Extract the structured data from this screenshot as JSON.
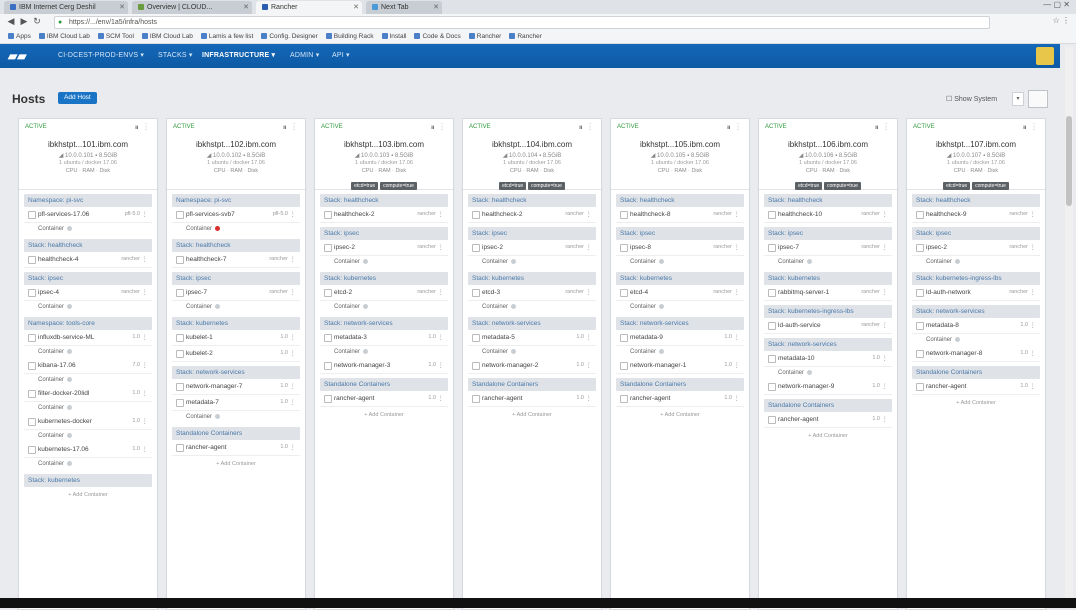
{
  "browser": {
    "tabs": [
      {
        "label": "IBM Internet Cerg Deshil",
        "color": "#3a6fc4",
        "active": false
      },
      {
        "label": "Overview | CLOUD...",
        "color": "#6a9b3c",
        "active": false
      },
      {
        "label": "Rancher",
        "color": "#2a5db0",
        "active": true
      },
      {
        "label": "Next Tab",
        "color": "#4a9ad8",
        "active": false
      }
    ],
    "url": "https://.../env/1a5/infra/hosts",
    "bookmarks": [
      "Apps",
      "IBM Cloud Lab",
      "SCM Tool",
      "IBM Cloud Lab",
      "Lamis a few list",
      "Config. Designer",
      "Building Rack",
      "Install",
      "Code & Docs",
      "Rancher",
      "Rancher"
    ]
  },
  "appnav": {
    "logo": "▰▰",
    "items": [
      {
        "label": "CI-DCEST-PROD-ENVS ▾",
        "active": false
      },
      {
        "label": "STACKS ▾",
        "active": false
      },
      {
        "label": "INFRASTRUCTURE ▾",
        "active": true
      },
      {
        "label": "ADMIN ▾",
        "active": false
      },
      {
        "label": "API ▾",
        "active": false
      }
    ]
  },
  "page": {
    "title": "Hosts",
    "add_host": "Add Host",
    "show_system": "Show System",
    "view_toggle": "▾"
  },
  "hosts": [
    {
      "state": "ACTIVE",
      "name": "ibkhstpt...101.ibm.com",
      "meta": "◢ 10.0.0.101 ▪ 8.5GiB",
      "sub": "1 ubuntu / docker 17.06",
      "stats": "CPU  ·  RAM  ·  Disk",
      "labels": [],
      "stacks": [
        {
          "title": "Namespace: pi-svc",
          "services": [
            {
              "name": "pfl-services-17.06",
              "ver": "pfl-5.0",
              "containers": 1,
              "red": false
            }
          ]
        },
        {
          "title": "Stack: healthcheck",
          "services": [
            {
              "name": "healthcheck-4",
              "ver": "rancher",
              "containers": 0,
              "red": false
            }
          ]
        },
        {
          "title": "Stack: ipsec",
          "services": [
            {
              "name": "ipsec-4",
              "ver": "rancher",
              "containers": 1,
              "red": false
            }
          ]
        },
        {
          "title": "Namespace: tools-core",
          "services": [
            {
              "name": "influxdb-service-ML",
              "ver": "1.0",
              "containers": 1,
              "red": false
            },
            {
              "name": "kibana-17.06",
              "ver": "7.0",
              "containers": 1,
              "red": false
            },
            {
              "name": "filter-docker-20lidl",
              "ver": "1.0",
              "containers": 1,
              "red": false
            },
            {
              "name": "kubernetes-docker",
              "ver": "1.0",
              "containers": 1,
              "red": false
            },
            {
              "name": "kubernetes-17.06",
              "ver": "1.0",
              "containers": 1,
              "red": false
            }
          ]
        },
        {
          "title": "Stack: kubernetes",
          "services": []
        }
      ]
    },
    {
      "state": "ACTIVE",
      "name": "ibkhstpt...102.ibm.com",
      "meta": "◢ 10.0.0.102 ▪ 8.5GiB",
      "sub": "1 ubuntu / docker 17.06",
      "stats": "CPU  ·  RAM  ·  Disk",
      "labels": [],
      "stacks": [
        {
          "title": "Namespace: pi-svc",
          "services": [
            {
              "name": "pfl-services-svb7",
              "ver": "pfl-5.0",
              "containers": 1,
              "red": true
            }
          ]
        },
        {
          "title": "Stack: healthcheck",
          "services": [
            {
              "name": "healthcheck-7",
              "ver": "rancher",
              "containers": 0,
              "red": false
            }
          ]
        },
        {
          "title": "Stack: ipsec",
          "services": [
            {
              "name": "ipsec-7",
              "ver": "rancher",
              "containers": 1,
              "red": false
            }
          ]
        },
        {
          "title": "Stack: kubernetes",
          "services": [
            {
              "name": "kubelet-1",
              "ver": "1.0",
              "containers": 0,
              "red": false
            },
            {
              "name": "kubelet-2",
              "ver": "1.0",
              "containers": 0,
              "red": false
            }
          ]
        },
        {
          "title": "Stack: network-services",
          "services": [
            {
              "name": "network-manager-7",
              "ver": "1.0",
              "containers": 0,
              "red": false
            },
            {
              "name": "metadata-7",
              "ver": "1.0",
              "containers": 1,
              "red": false
            }
          ]
        },
        {
          "title": "Standalone Containers",
          "services": [
            {
              "name": "rancher-agent",
              "ver": "1.0",
              "containers": 0,
              "red": false
            }
          ]
        }
      ]
    },
    {
      "state": "ACTIVE",
      "name": "ibkhstpt...103.ibm.com",
      "meta": "◢ 10.0.0.103 ▪ 8.5GiB",
      "sub": "1 ubuntu / docker 17.06",
      "stats": "CPU  ·  RAM  ·  Disk",
      "labels": [
        "etcd=true",
        "compute=true"
      ],
      "stacks": [
        {
          "title": "Stack: healthcheck",
          "services": [
            {
              "name": "healthcheck-2",
              "ver": "rancher",
              "containers": 0,
              "red": false
            }
          ]
        },
        {
          "title": "Stack: ipsec",
          "services": [
            {
              "name": "ipsec-2",
              "ver": "rancher",
              "containers": 1,
              "red": false
            }
          ]
        },
        {
          "title": "Stack: kubernetes",
          "services": [
            {
              "name": "etcd-2",
              "ver": "rancher",
              "containers": 1,
              "red": false
            }
          ]
        },
        {
          "title": "Stack: network-services",
          "services": [
            {
              "name": "metadata-3",
              "ver": "1.0",
              "containers": 1,
              "red": false
            },
            {
              "name": "network-manager-3",
              "ver": "1.0",
              "containers": 0,
              "red": false
            }
          ]
        },
        {
          "title": "Standalone Containers",
          "services": [
            {
              "name": "rancher-agent",
              "ver": "1.0",
              "containers": 0,
              "red": false
            }
          ]
        }
      ]
    },
    {
      "state": "ACTIVE",
      "name": "ibkhstpt...104.ibm.com",
      "meta": "◢ 10.0.0.104 ▪ 8.5GiB",
      "sub": "1 ubuntu / docker 17.06",
      "stats": "CPU  ·  RAM  ·  Disk",
      "labels": [
        "etcd=true",
        "compute=true"
      ],
      "stacks": [
        {
          "title": "Stack: healthcheck",
          "services": [
            {
              "name": "healthcheck-2",
              "ver": "rancher",
              "containers": 0,
              "red": false
            }
          ]
        },
        {
          "title": "Stack: ipsec",
          "services": [
            {
              "name": "ipsec-2",
              "ver": "rancher",
              "containers": 1,
              "red": false
            }
          ]
        },
        {
          "title": "Stack: kubernetes",
          "services": [
            {
              "name": "etcd-3",
              "ver": "rancher",
              "containers": 1,
              "red": false
            }
          ]
        },
        {
          "title": "Stack: network-services",
          "services": [
            {
              "name": "metadata-5",
              "ver": "1.0",
              "containers": 1,
              "red": false
            },
            {
              "name": "network-manager-2",
              "ver": "1.0",
              "containers": 0,
              "red": false
            }
          ]
        },
        {
          "title": "Standalone Containers",
          "services": [
            {
              "name": "rancher-agent",
              "ver": "1.0",
              "containers": 0,
              "red": false
            }
          ]
        }
      ]
    },
    {
      "state": "ACTIVE",
      "name": "ibkhstpt...105.ibm.com",
      "meta": "◢ 10.0.0.105 ▪ 8.5GiB",
      "sub": "1 ubuntu / docker 17.06",
      "stats": "CPU  ·  RAM  ·  Disk",
      "labels": [],
      "stacks": [
        {
          "title": "Stack: healthcheck",
          "services": [
            {
              "name": "healthcheck-8",
              "ver": "rancher",
              "containers": 0,
              "red": false
            }
          ]
        },
        {
          "title": "Stack: ipsec",
          "services": [
            {
              "name": "ipsec-8",
              "ver": "rancher",
              "containers": 1,
              "red": false
            }
          ]
        },
        {
          "title": "Stack: kubernetes",
          "services": [
            {
              "name": "etcd-4",
              "ver": "rancher",
              "containers": 1,
              "red": false
            }
          ]
        },
        {
          "title": "Stack: network-services",
          "services": [
            {
              "name": "metadata-9",
              "ver": "1.0",
              "containers": 1,
              "red": false
            },
            {
              "name": "network-manager-1",
              "ver": "1.0",
              "containers": 0,
              "red": false
            }
          ]
        },
        {
          "title": "Standalone Containers",
          "services": [
            {
              "name": "rancher-agent",
              "ver": "1.0",
              "containers": 0,
              "red": false
            }
          ]
        }
      ]
    },
    {
      "state": "ACTIVE",
      "name": "ibkhstpt...106.ibm.com",
      "meta": "◢ 10.0.0.106 ▪ 8.5GiB",
      "sub": "1 ubuntu / docker 17.06",
      "stats": "CPU  ·  RAM  ·  Disk",
      "labels": [
        "etcd=true",
        "compute=true"
      ],
      "stacks": [
        {
          "title": "Stack: healthcheck",
          "services": [
            {
              "name": "healthcheck-10",
              "ver": "rancher",
              "containers": 0,
              "red": false
            }
          ]
        },
        {
          "title": "Stack: ipsec",
          "services": [
            {
              "name": "ipsec-7",
              "ver": "rancher",
              "containers": 1,
              "red": false
            }
          ]
        },
        {
          "title": "Stack: kubernetes",
          "services": [
            {
              "name": "rabbitmq-server-1",
              "ver": "rancher",
              "containers": 0,
              "red": false
            }
          ]
        },
        {
          "title": "Stack: kubernetes-ingress-lbs",
          "services": [
            {
              "name": "ld-auth-service",
              "ver": "rancher",
              "containers": 0,
              "red": false
            }
          ]
        },
        {
          "title": "Stack: network-services",
          "services": [
            {
              "name": "metadata-10",
              "ver": "1.0",
              "containers": 1,
              "red": false
            },
            {
              "name": "network-manager-9",
              "ver": "1.0",
              "containers": 0,
              "red": false
            }
          ]
        },
        {
          "title": "Standalone Containers",
          "services": [
            {
              "name": "rancher-agent",
              "ver": "1.0",
              "containers": 0,
              "red": false
            }
          ]
        }
      ]
    },
    {
      "state": "ACTIVE",
      "name": "ibkhstpt...107.ibm.com",
      "meta": "◢ 10.0.0.107 ▪ 8.5GiB",
      "sub": "1 ubuntu / docker 17.06",
      "stats": "CPU  ·  RAM  ·  Disk",
      "labels": [
        "etcd=true",
        "compute=true"
      ],
      "stacks": [
        {
          "title": "Stack: healthcheck",
          "services": [
            {
              "name": "healthcheck-9",
              "ver": "rancher",
              "containers": 0,
              "red": false
            }
          ]
        },
        {
          "title": "Stack: ipsec",
          "services": [
            {
              "name": "ipsec-2",
              "ver": "rancher",
              "containers": 1,
              "red": false
            }
          ]
        },
        {
          "title": "Stack: kubernetes-ingress-lbs",
          "services": [
            {
              "name": "ld-auth-network",
              "ver": "rancher",
              "containers": 0,
              "red": false
            }
          ]
        },
        {
          "title": "Stack: network-services",
          "services": [
            {
              "name": "metadata-8",
              "ver": "1.0",
              "containers": 1,
              "red": false
            },
            {
              "name": "network-manager-8",
              "ver": "1.0",
              "containers": 0,
              "red": false
            }
          ]
        },
        {
          "title": "Standalone Containers",
          "services": [
            {
              "name": "rancher-agent",
              "ver": "1.0",
              "containers": 0,
              "red": false
            }
          ]
        }
      ]
    }
  ],
  "strings": {
    "container_label": "Container",
    "add_container": "+ Add Container"
  }
}
